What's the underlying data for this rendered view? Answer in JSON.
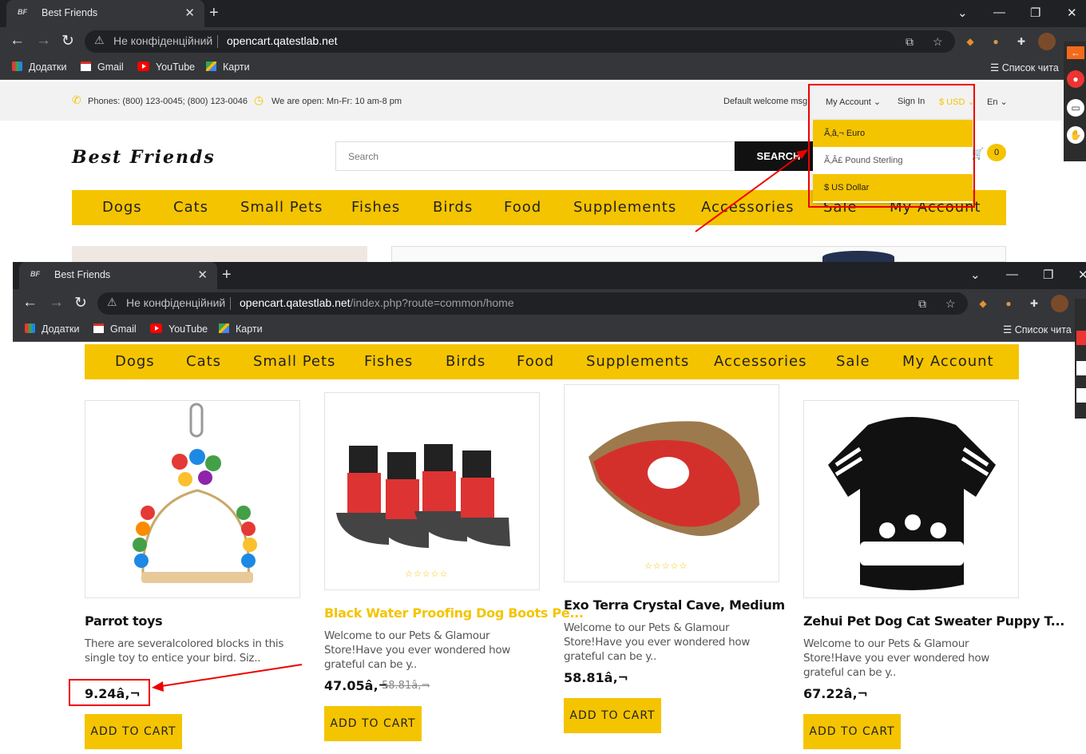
{
  "browser_top": {
    "tab_title": "Best Friends",
    "tab_favicon": "BF",
    "new_tab": "+",
    "not_secure": "Не конфіденційний",
    "url_host": "opencart.qatestlab.net",
    "url_path": "",
    "bookmarks": [
      "Додатки",
      "Gmail",
      "YouTube",
      "Карти"
    ],
    "reading_list": "Список чита"
  },
  "browser_bottom": {
    "tab_title": "Best Friends",
    "tab_favicon": "BF",
    "new_tab": "+",
    "not_secure": "Не конфіденційний",
    "url_host": "opencart.qatestlab.net",
    "url_path": "/index.php?route=common/home",
    "bookmarks": [
      "Додатки",
      "Gmail",
      "YouTube",
      "Карти"
    ],
    "reading_list": "Список чита"
  },
  "site": {
    "phones": "Phones: (800) 123-0045; (800) 123-0046",
    "hours": "We are open: Mn-Fr: 10 am-8 pm",
    "welcome": "Default welcome msg!",
    "my_account": "My Account",
    "sign_in": "Sign In",
    "currency": "$ USD",
    "language": "En",
    "logo": "Best Friends",
    "search_placeholder": "Search",
    "search_button": "SEARCH",
    "cart_count": "0",
    "currency_options": [
      "Ã‚â‚¬ Euro",
      "Ã‚Â£ Pound Sterling",
      "$ US Dollar"
    ]
  },
  "menu": [
    "Dogs",
    "Cats",
    "Small Pets",
    "Fishes",
    "Birds",
    "Food",
    "Supplements",
    "Accessories",
    "Sale",
    "My Account"
  ],
  "products": [
    {
      "name": "Parrot toys",
      "desc": "There are severalcolored blocks in this single toy to entice your bird. Siz..",
      "price": "9.24â‚¬",
      "old_price": "",
      "button": "ADD TO CART"
    },
    {
      "name": "Black Water Proofing Dog Boots Pe...",
      "desc": "Welcome to our Pets & Glamour Store!Have you ever wondered how grateful can be y..",
      "price": "47.05â‚¬",
      "old_price": "58.81â‚¬",
      "button": "ADD TO CART"
    },
    {
      "name": "Exo Terra Crystal Cave, Medium",
      "desc": "Welcome to our Pets & Glamour Store!Have you ever wondered how grateful can be y..",
      "price": "58.81â‚¬",
      "old_price": "",
      "button": "ADD TO CART"
    },
    {
      "name": "Zehui Pet Dog Cat Sweater Puppy T...",
      "desc": "Welcome to our Pets & Glamour Store!Have you ever wondered how grateful can be y..",
      "price": "67.22â‚¬",
      "old_price": "",
      "button": "ADD TO CART"
    }
  ],
  "colors": {
    "accent": "#f5c400",
    "annotation": "#e00000",
    "chrome_dark": "#202124"
  }
}
